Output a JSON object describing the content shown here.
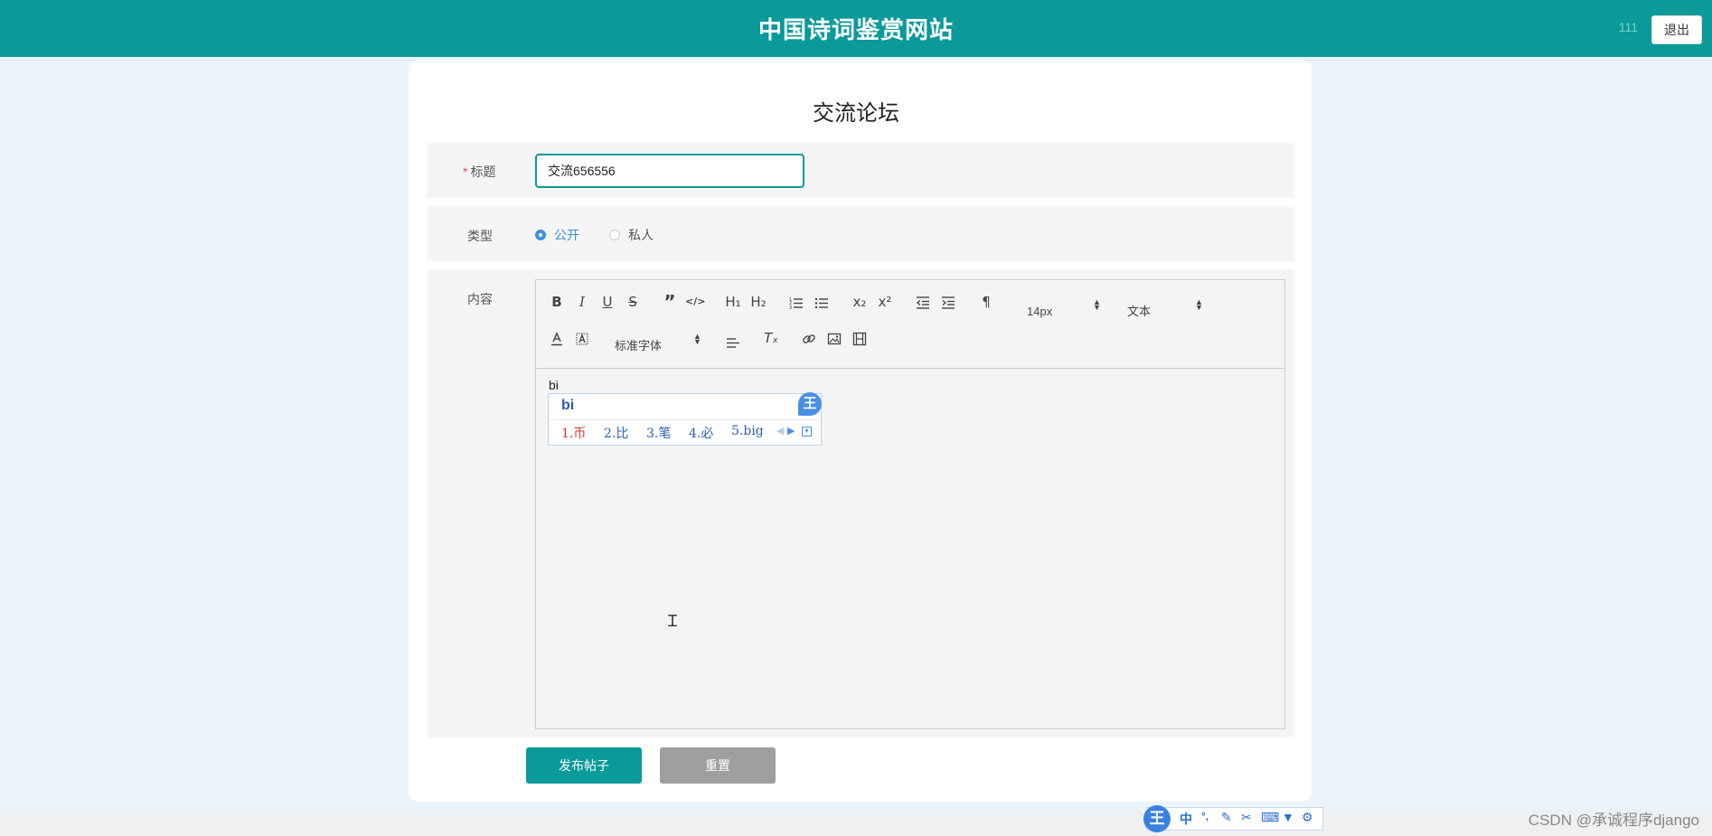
{
  "header": {
    "site_title": "中国诗词鉴赏网站",
    "user_name": "111",
    "logout_label": "退出"
  },
  "page": {
    "title": "交流论坛"
  },
  "form": {
    "title_label": "标题",
    "title_required_mark": "*",
    "title_value": "交流656556",
    "type_label": "类型",
    "type_options": [
      {
        "label": "公开",
        "checked": true
      },
      {
        "label": "私人",
        "checked": false
      }
    ],
    "content_label": "内容"
  },
  "editor": {
    "toolbar": {
      "bold": "B",
      "italic": "I",
      "underline": "U",
      "strike": "S",
      "blockquote": "”",
      "code": "</>",
      "h1": "H₁",
      "h2": "H₂",
      "subscript": "x₂",
      "superscript": "x²",
      "direction": "¶",
      "size_value": "14px",
      "header_value": "文本",
      "font_value": "标准字体",
      "clean": "Tₓ"
    },
    "typed_text": "bi"
  },
  "ime": {
    "input": "bi",
    "badge": "王",
    "candidates": [
      "1.币",
      "2.比",
      "3.笔",
      "4.必",
      "5.big"
    ],
    "bar_logo": "王",
    "bar_mode": "中",
    "bar_punct": "°,"
  },
  "buttons": {
    "publish_label": "发布帖子",
    "reset_label": "重置"
  },
  "watermark": "CSDN @承诚程序django"
}
